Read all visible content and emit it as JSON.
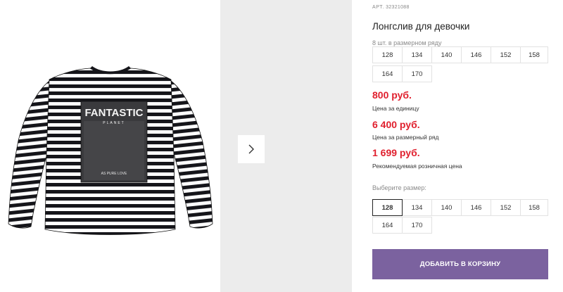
{
  "product": {
    "sku_label": "АРТ.",
    "sku_value": "32321088",
    "title": "Лонгслив для девочки",
    "pack_note": "8 шт. в размерном ряду",
    "pack_sizes": [
      "128",
      "134",
      "140",
      "146",
      "152",
      "158",
      "164",
      "170"
    ],
    "print": {
      "headline": "FANTASTIC",
      "subline": "PLANET",
      "tagline": "AS PURE LOVE"
    }
  },
  "prices": [
    {
      "amount": "800 руб.",
      "note": "Цена за единицу"
    },
    {
      "amount": "6 400 руб.",
      "note": "Цена за размерный ряд"
    },
    {
      "amount": "1 699 руб.",
      "note": "Рекомендуемая розничная цена"
    }
  ],
  "size_picker": {
    "label": "Выберите размер:",
    "options": [
      "128",
      "134",
      "140",
      "146",
      "152",
      "158",
      "164",
      "170"
    ],
    "selected": "128"
  },
  "cart_button": {
    "label": "ДОБАВИТЬ В КОРЗИНУ"
  },
  "colors": {
    "price": "#e0202e",
    "cart_button": "#7b629f",
    "side_photo_bg": "#ececec"
  },
  "icons": {
    "next": "chevron-right-icon"
  }
}
